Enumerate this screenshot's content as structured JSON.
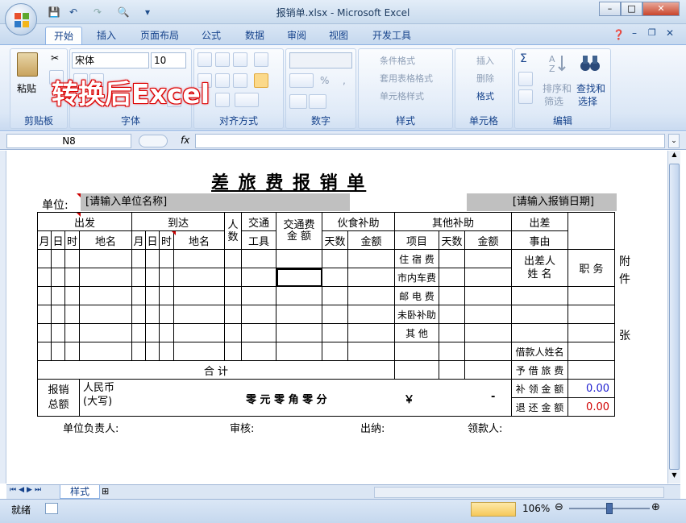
{
  "window": {
    "title": "报销单.xlsx - Microsoft Excel"
  },
  "qat": {
    "save": "💾",
    "undo": "↶",
    "redo": "↷",
    "preview": "🔍",
    "more": "▾"
  },
  "tabs": [
    "开始",
    "插入",
    "页面布局",
    "公式",
    "数据",
    "审阅",
    "视图",
    "开发工具"
  ],
  "ribbon": {
    "clipboard": {
      "label": "剪贴板",
      "paste": "粘贴"
    },
    "font": {
      "label": "字体",
      "name": "宋体",
      "size": "10"
    },
    "align": {
      "label": "对齐方式"
    },
    "number": {
      "label": "数字",
      "percent": "%",
      "comma": ","
    },
    "style": {
      "label": "样式",
      "cond": "条件格式",
      "table": "套用表格格式",
      "cell": "单元格样式"
    },
    "cells": {
      "label": "单元格",
      "insert": "插入",
      "delete": "删除",
      "format": "格式"
    },
    "edit": {
      "label": "编辑",
      "sigma": "Σ",
      "sort": "排序和",
      "filter": "筛选",
      "find": "查找和",
      "select": "选择"
    }
  },
  "overlay_text": "转换后Excel",
  "formula": {
    "namebox": "N8",
    "fx": "fx"
  },
  "form": {
    "title": "差 旅 费 报 销 单",
    "unit_label": "单位:",
    "unit_value": "[请输入单位名称]",
    "date_value": "[请输入报销日期]",
    "h_depart": "出发",
    "h_arrive": "到达",
    "h_people": "人数",
    "h_trans": "交通",
    "h_tools": "工具",
    "h_fee": "交通费",
    "h_fee2": "金  额",
    "h_meal": "伙食补助",
    "h_other": "其他补助",
    "h_reason": "出差",
    "h_reason2": "事由",
    "m": "月",
    "d": "日",
    "t": "时",
    "place": "地名",
    "days": "天数",
    "amount": "金额",
    "item": "项目",
    "other_items": [
      "住 宿 费",
      "市内车费",
      "邮 电 费",
      "未卧补助",
      "其    他"
    ],
    "traveler": "出差人",
    "traveler2": "姓  名",
    "position": "职  务",
    "attach": "附",
    "attach2": "件",
    "zhang": "张",
    "total": "合          计",
    "borrower": "借款人姓名",
    "advance": "予 借 旅 费",
    "supplement": "补 领 金 额",
    "refund": "退 还 金 额",
    "supplement_val": "0.00",
    "refund_val": "0.00",
    "reimb": "报销",
    "total2": "总额",
    "rmb": "人民币",
    "upper": "(大写)",
    "words": "零 元 零 角 零 分",
    "yen": "￥",
    "dash": "-",
    "f_unit": "单位负责人:",
    "f_audit": "审核:",
    "f_cashier": "出纳:",
    "f_recv": "领款人:"
  },
  "sheettab": "样式",
  "status": {
    "ready": "就绪",
    "zoom": "106%"
  }
}
